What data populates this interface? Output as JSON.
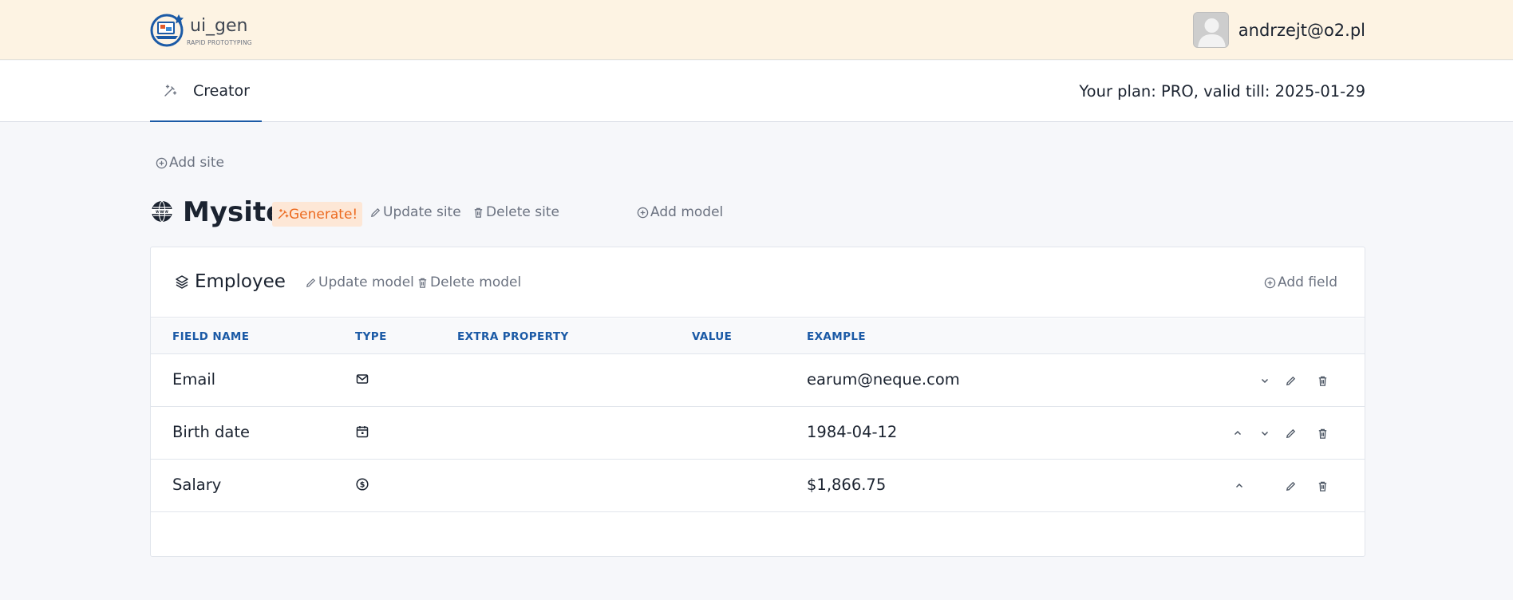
{
  "header": {
    "logo_title": "ui_gen",
    "logo_subtitle": "RAPID PROTOTYPING",
    "user_email": "andrzejt@o2.pl"
  },
  "nav": {
    "tab_label": "Creator",
    "plan_text": "Your plan: PRO, valid till: 2025-01-29"
  },
  "toolbar": {
    "add_site": "Add site"
  },
  "site": {
    "name": "Mysite",
    "generate": "Generate!",
    "update": "Update site",
    "delete": "Delete site",
    "add_model": "Add model"
  },
  "model": {
    "name": "Employee",
    "update": "Update model",
    "delete": "Delete model",
    "add_field": "Add field"
  },
  "table": {
    "columns": [
      "FIELD NAME",
      "TYPE",
      "EXTRA PROPERTY",
      "VALUE",
      "EXAMPLE"
    ],
    "rows": [
      {
        "field_name": "Email",
        "type_icon": "mail-icon",
        "extra_property": "",
        "value": "",
        "example": "earum@neque.com"
      },
      {
        "field_name": "Birth date",
        "type_icon": "calendar-icon",
        "extra_property": "",
        "value": "",
        "example": "1984-04-12"
      },
      {
        "field_name": "Salary",
        "type_icon": "dollar-icon",
        "extra_property": "",
        "value": "",
        "example": "$1,866.75"
      }
    ]
  },
  "colors": {
    "topbar_bg": "#fdf3e3",
    "accent_blue": "#1b5aa6",
    "generate_orange": "#ec6a1f",
    "generate_bg": "#fde7d6",
    "page_bg": "#f6f7fa"
  }
}
